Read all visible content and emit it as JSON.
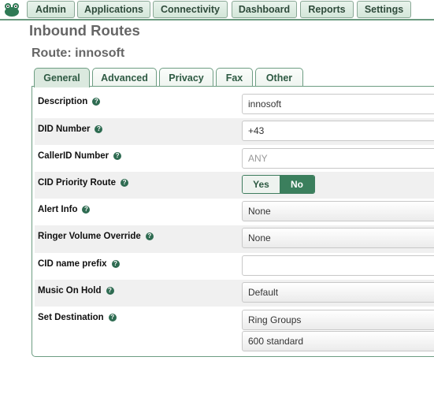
{
  "nav": {
    "buttons": [
      "Admin",
      "Applications",
      "Connectivity",
      "Dashboard",
      "Reports",
      "Settings"
    ]
  },
  "page": {
    "title": "Inbound Routes",
    "route_title": "Route: innosoft"
  },
  "tabs": [
    "General",
    "Advanced",
    "Privacy",
    "Fax",
    "Other"
  ],
  "active_tab": "General",
  "help_glyph": "?",
  "form": {
    "description": {
      "label": "Description",
      "value": "innosoft"
    },
    "did_number": {
      "label": "DID Number",
      "value": "+43"
    },
    "callerid_number": {
      "label": "CallerID Number",
      "placeholder": "ANY"
    },
    "cid_priority_route": {
      "label": "CID Priority Route",
      "yes_label": "Yes",
      "no_label": "No",
      "selected": "No"
    },
    "alert_info": {
      "label": "Alert Info",
      "value": "None"
    },
    "ringer_volume_override": {
      "label": "Ringer Volume Override",
      "value": "None"
    },
    "cid_name_prefix": {
      "label": "CID name prefix",
      "value": ""
    },
    "music_on_hold": {
      "label": "Music On Hold",
      "value": "Default"
    },
    "set_destination": {
      "label": "Set Destination",
      "category": "Ring Groups",
      "target": "600 standard"
    }
  },
  "colors": {
    "accent": "#3b7f5d",
    "border": "#6d9d82",
    "shaded_row": "#f0f0f0"
  }
}
